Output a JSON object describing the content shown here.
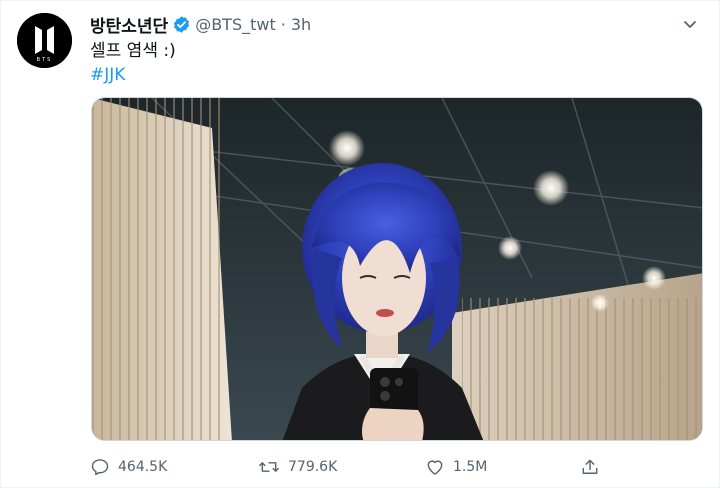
{
  "account": {
    "display_name": "방탄소년단",
    "handle": "@BTS_twt",
    "separator": "·",
    "time": "3h",
    "avatar_text": "BTS"
  },
  "tweet": {
    "text": "셀프 염색 :)",
    "hashtag": "#JJK"
  },
  "actions": {
    "replies": "464.5K",
    "retweets": "779.6K",
    "likes": "1.5M"
  },
  "colors": {
    "link": "#1d9bf0",
    "muted": "#536471",
    "verified": "#1d9bf0"
  },
  "icons": [
    "verified-badge-icon",
    "more-caret-icon",
    "reply-icon",
    "retweet-icon",
    "like-icon",
    "share-icon"
  ]
}
